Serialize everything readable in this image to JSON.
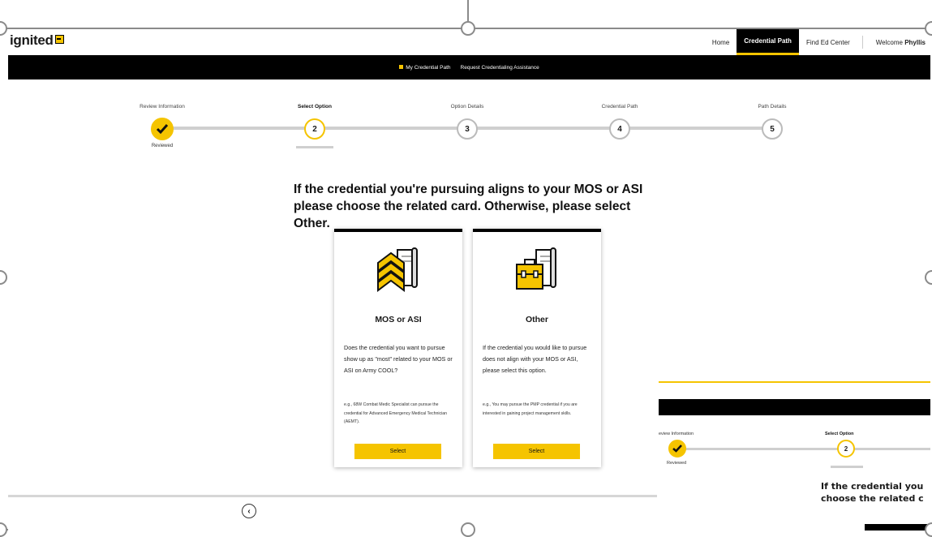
{
  "header": {
    "logo_text": "ignited",
    "nav": [
      "Home",
      "Credential Path",
      "Find Ed Center"
    ],
    "welcome_label": "Welcome",
    "welcome_name": "Phyllis"
  },
  "subnav": {
    "items": [
      "My Credential Path",
      "Request Credentialing Assistance"
    ]
  },
  "stepper": {
    "steps": [
      {
        "label": "Review Information",
        "number": "",
        "status": "Reviewed"
      },
      {
        "label": "Select Option",
        "number": "2",
        "status": ""
      },
      {
        "label": "Option Details",
        "number": "3",
        "status": ""
      },
      {
        "label": "Credential Path",
        "number": "4",
        "status": ""
      },
      {
        "label": "Path Details",
        "number": "5",
        "status": ""
      }
    ]
  },
  "question": "If the credential you're pursuing aligns to your MOS or ASI please choose the related card. Otherwise, please select Other.",
  "cards": [
    {
      "title": "MOS or ASI",
      "description": "Does the credential you want to pursue show up as \"most\" related to your MOS or ASI on Army COOL?",
      "example": "e.g., 68W Combat Medic Specialist can pursue the credential for Advanced Emergency Medical Technician (AEMT).",
      "button": "Select"
    },
    {
      "title": "Other",
      "description": "If the credential you would like to pursue does not align with your MOS or ASI, please select this option.",
      "example": "e.g., You may pursue the PMP credential if you are interested in gaining project management skills.",
      "button": "Select"
    }
  ],
  "back_button": "‹",
  "overlay": {
    "step1_label": "eview Information",
    "step1_status": "Reviewed",
    "step2_label": "Select Option",
    "step2_number": "2",
    "question_line1": "If the credential you",
    "question_line2": "choose the related c"
  },
  "colors": {
    "accent": "#f5c400",
    "dark": "#000000"
  }
}
